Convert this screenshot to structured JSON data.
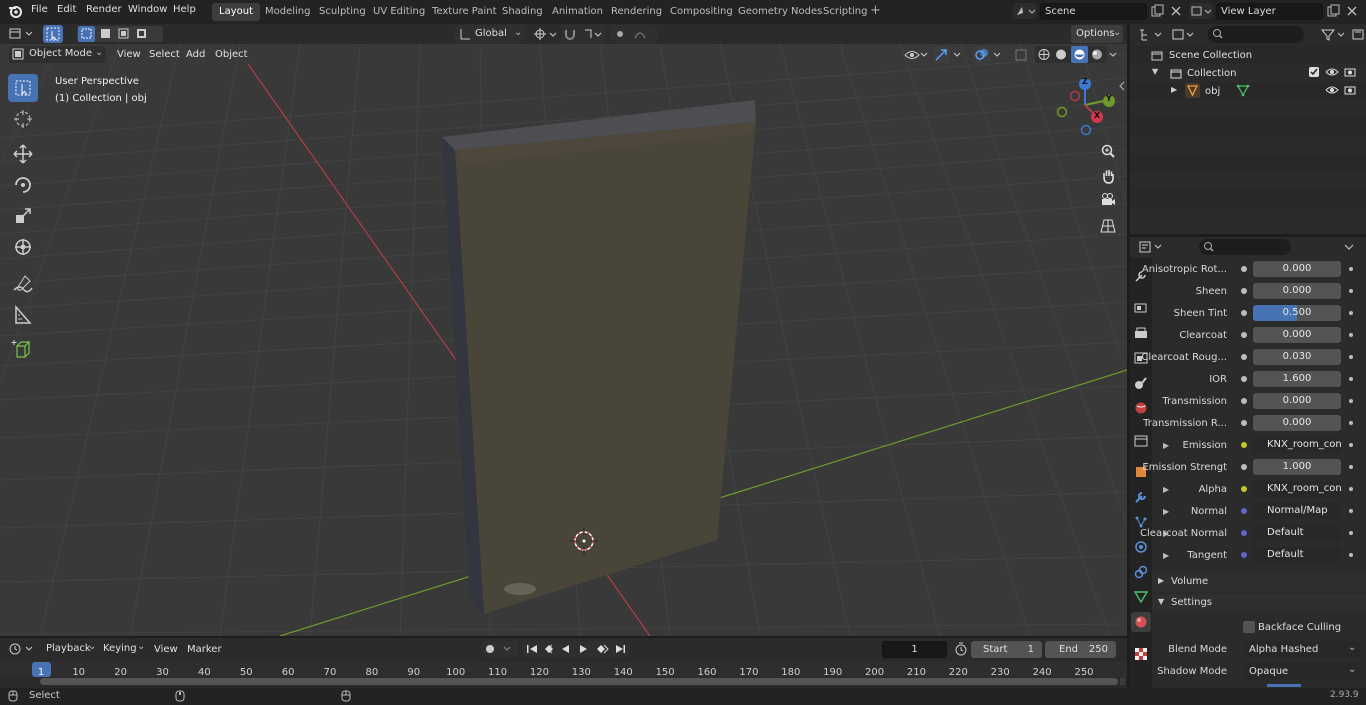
{
  "menu": {
    "file": "File",
    "edit": "Edit",
    "render": "Render",
    "window": "Window",
    "help": "Help"
  },
  "workspaces": [
    "Layout",
    "Modeling",
    "Sculpting",
    "UV Editing",
    "Texture Paint",
    "Shading",
    "Animation",
    "Rendering",
    "Compositing",
    "Geometry Nodes",
    "Scripting"
  ],
  "active_workspace": "Layout",
  "scene": {
    "name": "Scene",
    "view_layer": "View Layer"
  },
  "viewport": {
    "mode": "Object Mode",
    "view": "View",
    "select": "Select",
    "add": "Add",
    "object": "Object",
    "orientation": "Global",
    "options": "Options",
    "overlay_title": "User Perspective",
    "overlay_subtitle": "(1) Collection | obj",
    "gizmo": {
      "z": "Z",
      "y": "Y",
      "x": "X"
    }
  },
  "outliner": {
    "scene_collection": "Scene Collection",
    "collection": "Collection",
    "object": "obj"
  },
  "properties": {
    "rows": [
      {
        "label": "Anisotropic Rot...",
        "value": "0.000",
        "type": "num"
      },
      {
        "label": "Sheen",
        "value": "0.000",
        "type": "num"
      },
      {
        "label": "Sheen Tint",
        "value": "0.500",
        "type": "num",
        "fill": 0.5
      },
      {
        "label": "Clearcoat",
        "value": "0.000",
        "type": "num"
      },
      {
        "label": "Clearcoat Roug...",
        "value": "0.030",
        "type": "num"
      },
      {
        "label": "IOR",
        "value": "1.600",
        "type": "num"
      },
      {
        "label": "Transmission",
        "value": "0.000",
        "type": "num"
      },
      {
        "label": "Transmission R...",
        "value": "0.000",
        "type": "num"
      },
      {
        "label": "Emission",
        "value": "KNX_room_control_...",
        "type": "link"
      },
      {
        "label": "Emission Strengt",
        "value": "1.000",
        "type": "num"
      },
      {
        "label": "Alpha",
        "value": "KNX_room_control_...",
        "type": "link"
      },
      {
        "label": "Normal",
        "value": "Normal/Map",
        "type": "link"
      },
      {
        "label": "Clearcoat Normal",
        "value": "Default",
        "type": "link"
      },
      {
        "label": "Tangent",
        "value": "Default",
        "type": "link"
      }
    ],
    "volume": "Volume",
    "settings": "Settings",
    "backface_culling": "Backface Culling",
    "blend_mode_label": "Blend Mode",
    "blend_mode": "Alpha Hashed",
    "shadow_mode_label": "Shadow Mode",
    "shadow_mode": "Opaque"
  },
  "timeline": {
    "playback": "Playback",
    "keying": "Keying",
    "view": "View",
    "marker": "Marker",
    "current_frame": "1",
    "start_label": "Start",
    "start": "1",
    "end_label": "End",
    "end": "250",
    "ticks": [
      "1",
      "10",
      "20",
      "30",
      "40",
      "50",
      "60",
      "70",
      "80",
      "90",
      "100",
      "110",
      "120",
      "130",
      "140",
      "150",
      "160",
      "170",
      "180",
      "190",
      "200",
      "210",
      "220",
      "230",
      "240",
      "250"
    ]
  },
  "status": {
    "select": "Select",
    "version": "2.93.9"
  },
  "colors": {
    "accent": "#4772b3",
    "header": "#232323",
    "viewport": "#3a3a3a",
    "x_axis": "#b23c4a",
    "y_axis": "#6f9b2c",
    "object": "#4a4539"
  }
}
